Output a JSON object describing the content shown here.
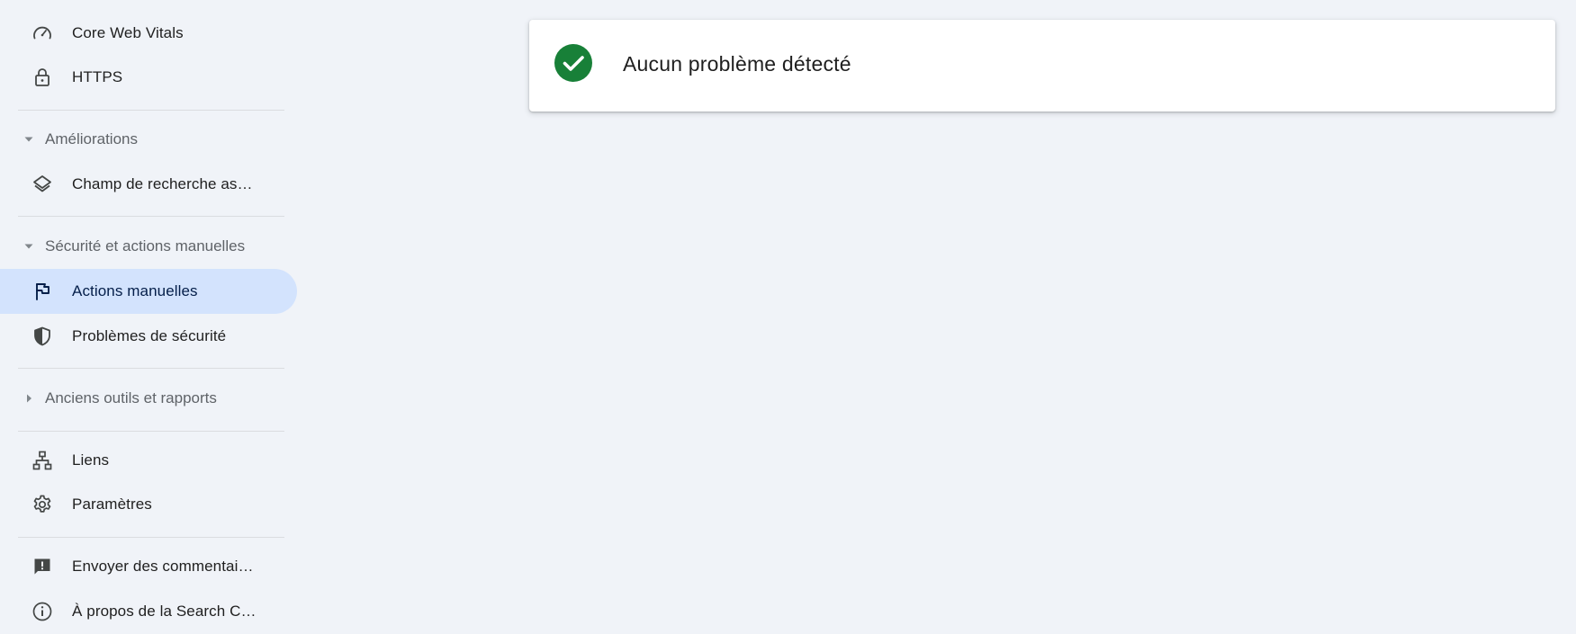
{
  "sidebar": {
    "items": [
      {
        "label": "Core Web Vitals",
        "icon": "speedometer-icon"
      },
      {
        "label": "HTTPS",
        "icon": "lock-icon"
      },
      {
        "label": "Champ de recherche as…",
        "icon": "layers-icon"
      },
      {
        "label": "Actions manuelles",
        "icon": "flag-icon",
        "active": true
      },
      {
        "label": "Problèmes de sécurité",
        "icon": "shield-icon"
      },
      {
        "label": "Liens",
        "icon": "sitemap-icon"
      },
      {
        "label": "Paramètres",
        "icon": "gear-icon"
      },
      {
        "label": "Envoyer des commentai…",
        "icon": "feedback-icon"
      },
      {
        "label": "À propos de la Search C…",
        "icon": "info-icon"
      }
    ],
    "sections": [
      {
        "label": "Améliorations",
        "expanded": true
      },
      {
        "label": "Sécurité et actions manuelles",
        "expanded": true
      },
      {
        "label": "Anciens outils et rapports",
        "expanded": false
      }
    ]
  },
  "main": {
    "status_title": "Aucun problème détecté",
    "status_icon": "check-circle-icon"
  },
  "colors": {
    "background": "#f0f3f8",
    "active_item": "#d3e3fd",
    "success": "#188038"
  }
}
